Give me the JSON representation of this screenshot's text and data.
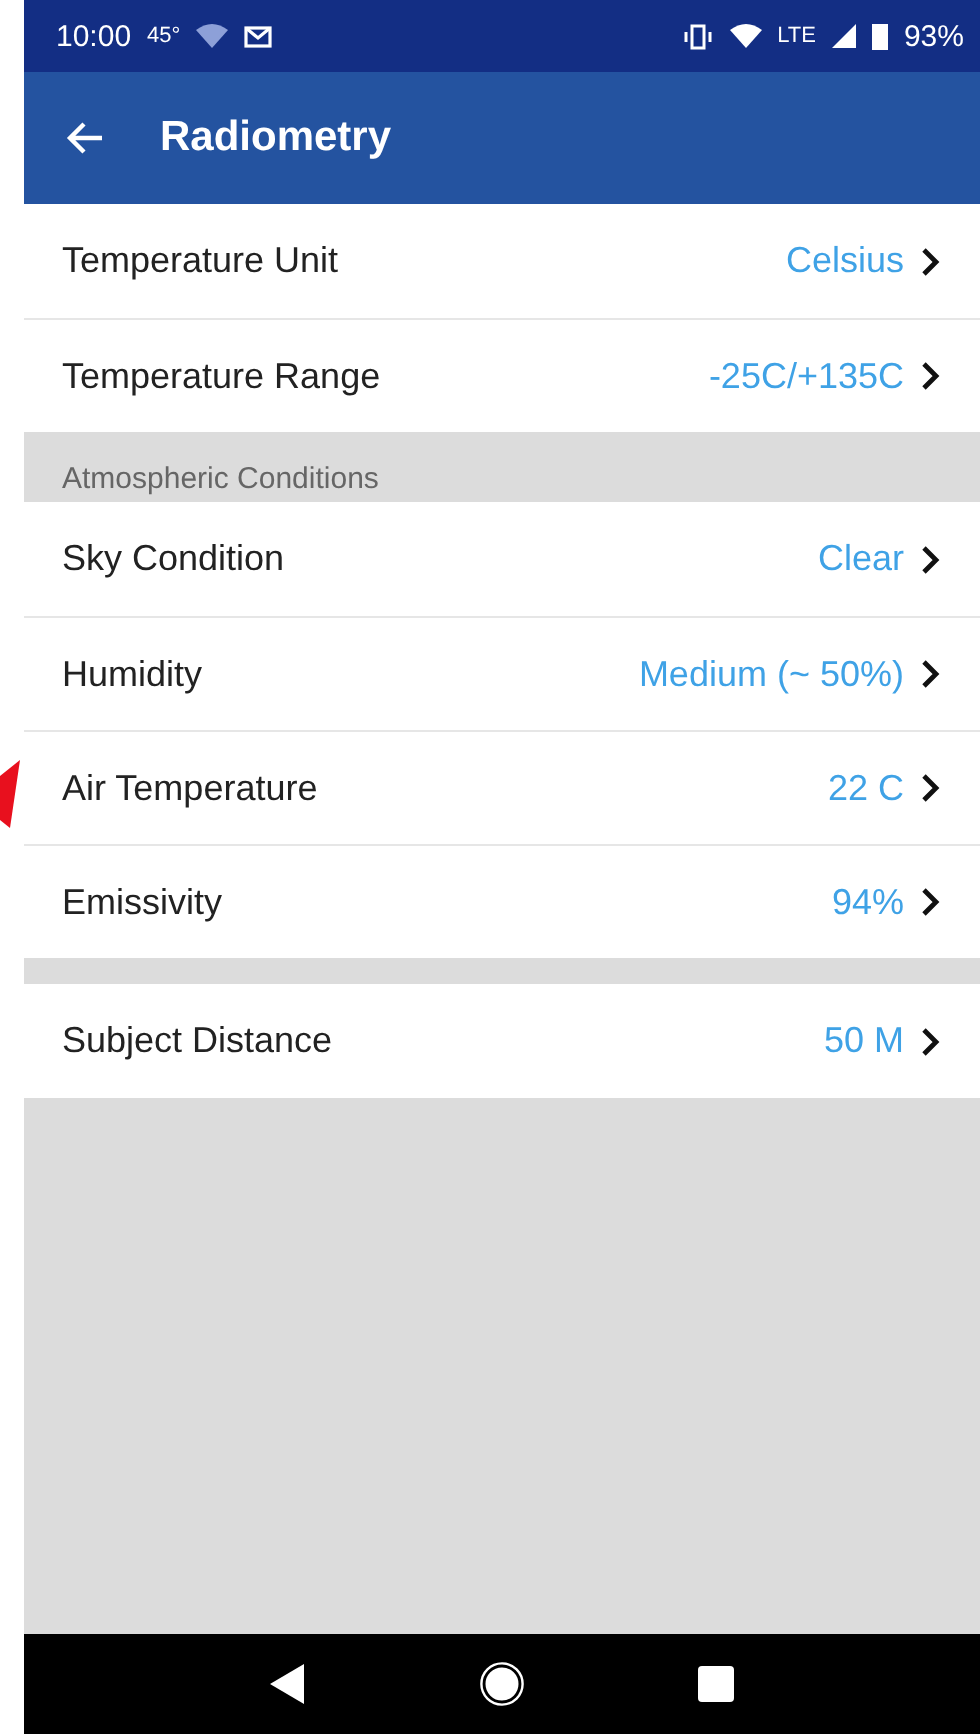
{
  "status_bar": {
    "time": "10:00",
    "temperature": "45°",
    "network": "LTE",
    "battery": "93%"
  },
  "app_bar": {
    "title": "Radiometry"
  },
  "sections": [
    {
      "items": [
        {
          "label": "Temperature Unit",
          "value": "Celsius"
        },
        {
          "label": "Temperature Range",
          "value": "-25C/+135C"
        }
      ]
    },
    {
      "header": "Atmospheric Conditions",
      "items": [
        {
          "label": "Sky Condition",
          "value": "Clear"
        },
        {
          "label": "Humidity",
          "value": "Medium (~ 50%)"
        },
        {
          "label": "Air Temperature",
          "value": "22 C"
        },
        {
          "label": "Emissivity",
          "value": "94%"
        }
      ]
    },
    {
      "items": [
        {
          "label": "Subject Distance",
          "value": "50 M"
        }
      ]
    }
  ]
}
